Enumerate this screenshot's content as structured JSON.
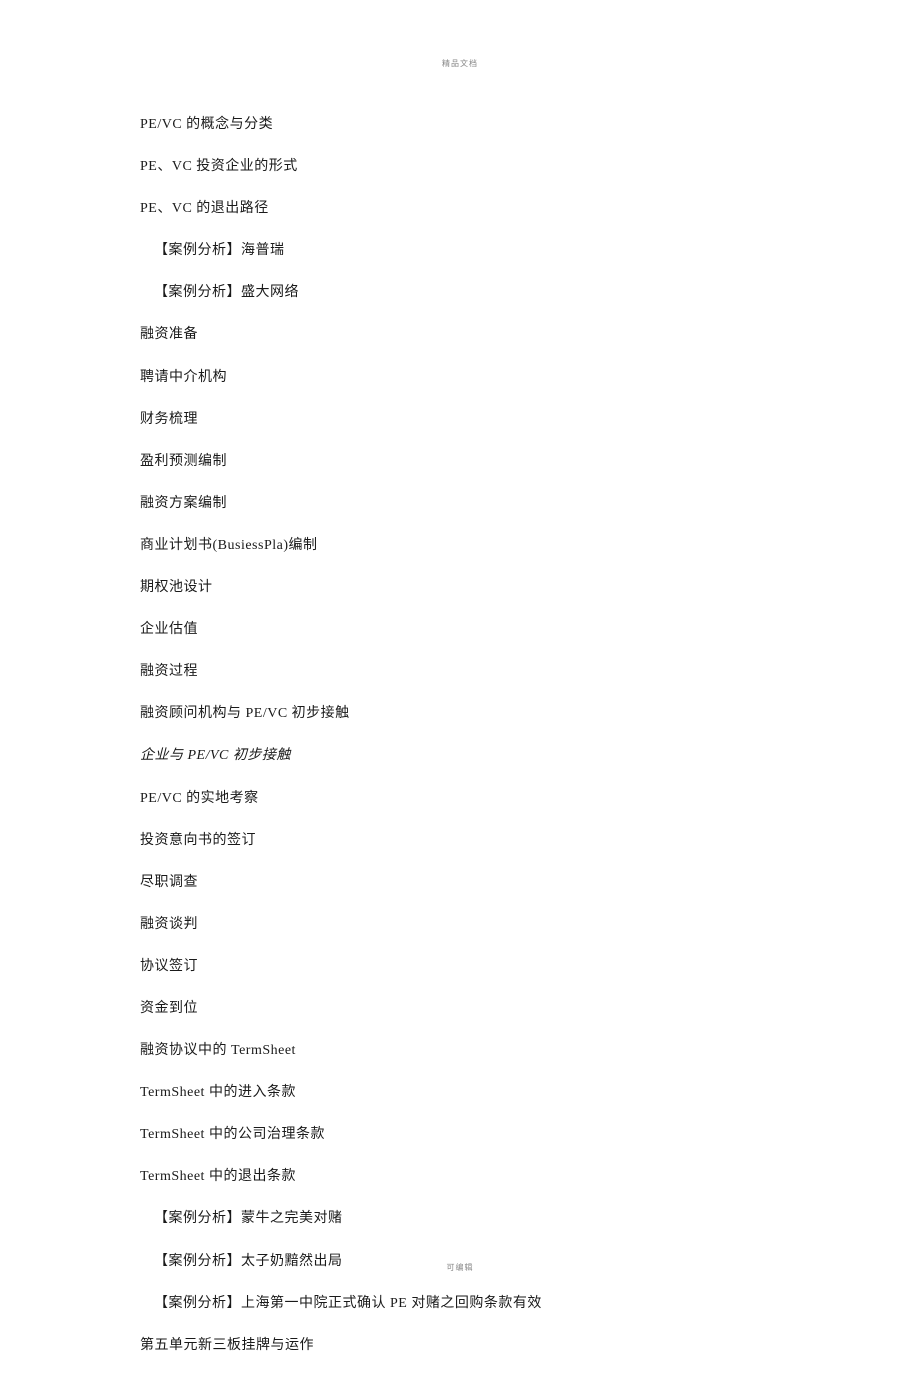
{
  "header": "精品文档",
  "footer": "可编辑",
  "lines": [
    {
      "text": "PE/VC 的概念与分类",
      "indent": 0
    },
    {
      "text": "PE、VC 投资企业的形式",
      "indent": 0
    },
    {
      "text": "PE、VC 的退出路径",
      "indent": 0
    },
    {
      "text": "【案例分析】海普瑞",
      "indent": 1
    },
    {
      "text": "【案例分析】盛大网络",
      "indent": 1
    },
    {
      "text": "融资准备",
      "indent": 0
    },
    {
      "text": "聘请中介机构",
      "indent": 0
    },
    {
      "text": "财务梳理",
      "indent": 0
    },
    {
      "text": "盈利预测编制",
      "indent": 0
    },
    {
      "text": "融资方案编制",
      "indent": 0
    },
    {
      "text": "商业计划书(BusiessPla)编制",
      "indent": 0
    },
    {
      "text": "期权池设计",
      "indent": 0
    },
    {
      "text": "企业估值",
      "indent": 0
    },
    {
      "text": "融资过程",
      "indent": 0
    },
    {
      "text": "融资顾问机构与 PE/VC 初步接触",
      "indent": 0
    },
    {
      "text": "企业与 PE/VC 初步接触",
      "indent": 0,
      "italic": true
    },
    {
      "text": "PE/VC 的实地考察",
      "indent": 0
    },
    {
      "text": "投资意向书的签订",
      "indent": 0
    },
    {
      "text": "尽职调查",
      "indent": 0
    },
    {
      "text": "融资谈判",
      "indent": 0
    },
    {
      "text": "协议签订",
      "indent": 0
    },
    {
      "text": "资金到位",
      "indent": 0
    },
    {
      "text": "融资协议中的 TermSheet",
      "indent": 0
    },
    {
      "text": "TermSheet 中的进入条款",
      "indent": 0
    },
    {
      "text": "TermSheet 中的公司治理条款",
      "indent": 0
    },
    {
      "text": "TermSheet 中的退出条款",
      "indent": 0
    },
    {
      "text": "【案例分析】蒙牛之完美对赌",
      "indent": 1
    },
    {
      "text": "【案例分析】太子奶黯然出局",
      "indent": 1
    },
    {
      "text": "【案例分析】上海第一中院正式确认 PE 对赌之回购条款有效",
      "indent": 1
    },
    {
      "text": "第五单元新三板挂牌与运作",
      "indent": 0
    }
  ]
}
